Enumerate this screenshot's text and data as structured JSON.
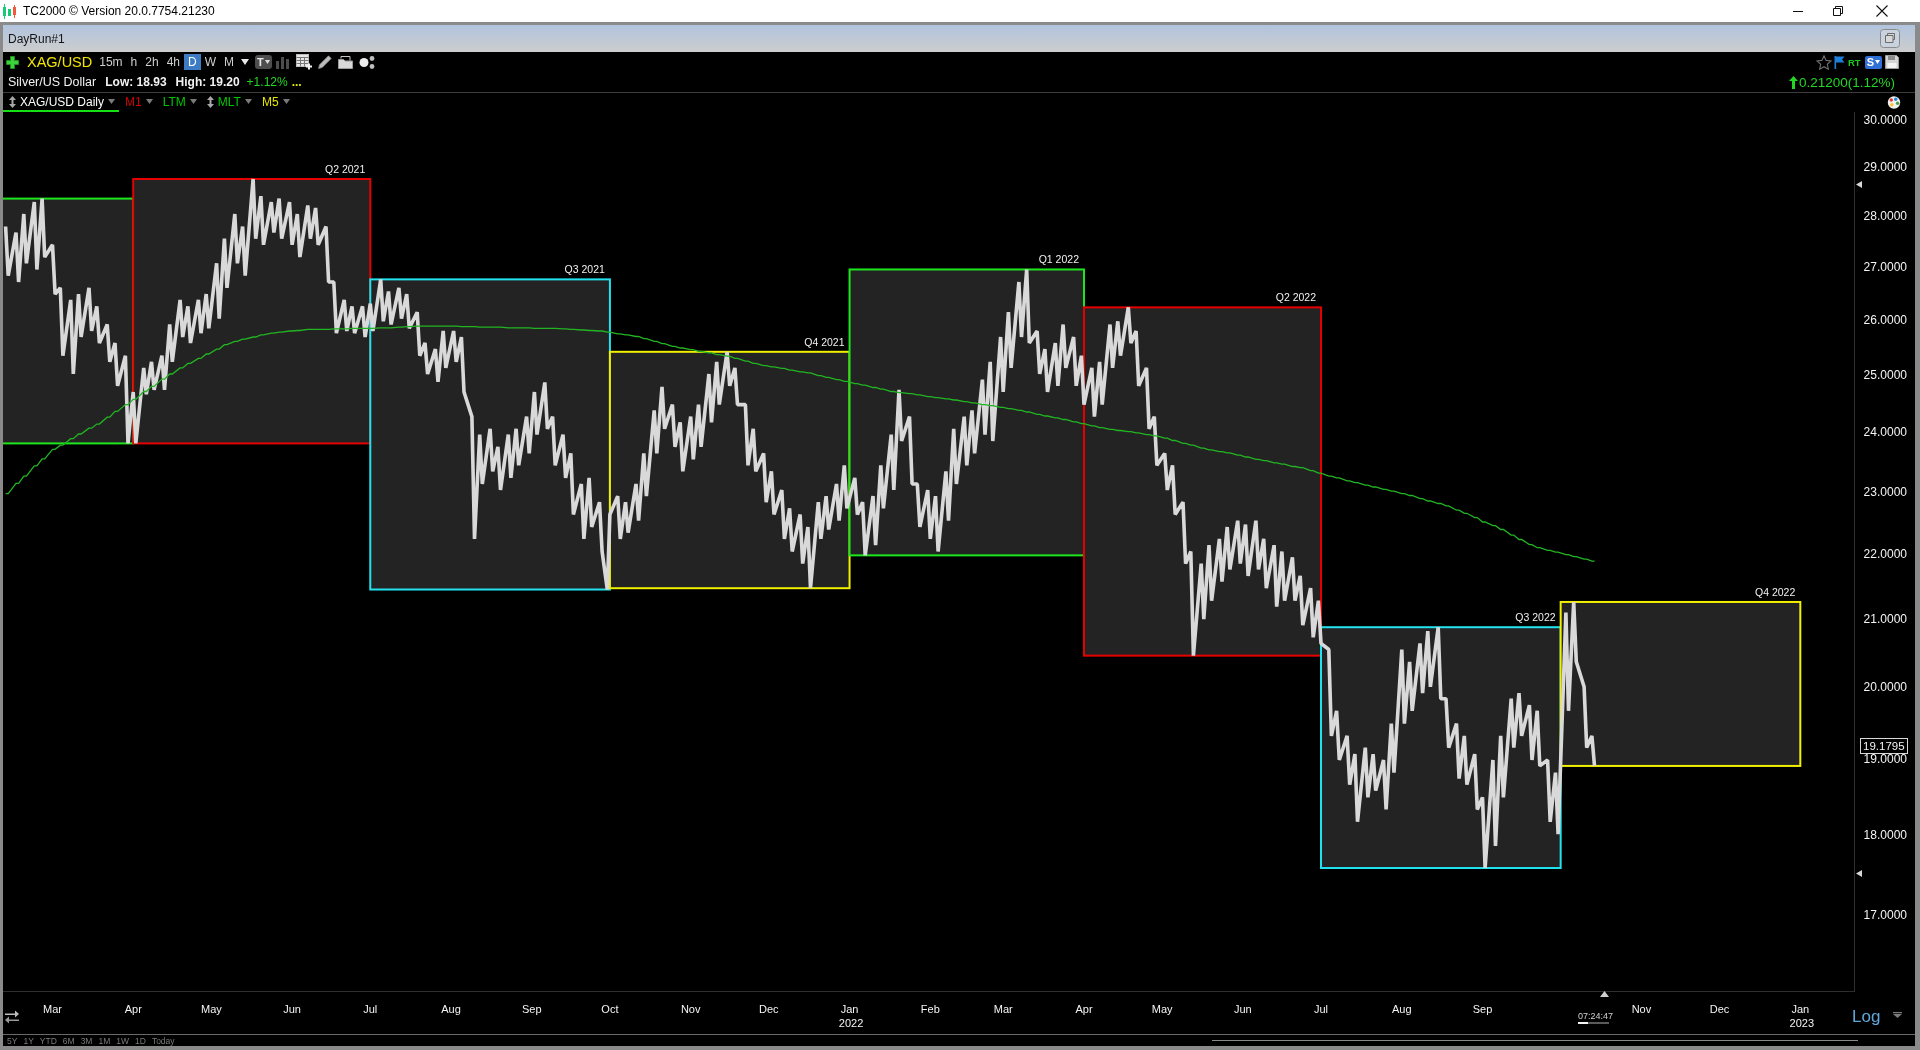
{
  "window": {
    "title": "TC2000 © Version 20.0.7754.21230"
  },
  "layout": {
    "title": "DayRun#1"
  },
  "toolbar": {
    "symbol": "XAG/USD",
    "timeframes": [
      {
        "label": "15m",
        "selected": false
      },
      {
        "label": "h",
        "selected": false
      },
      {
        "label": "2h",
        "selected": false
      },
      {
        "label": "4h",
        "selected": false
      },
      {
        "label": "D",
        "selected": true
      },
      {
        "label": "W",
        "selected": false
      },
      {
        "label": "M",
        "selected": false
      }
    ],
    "text_tool": "T",
    "realtime": "RT",
    "scan_menu": "S"
  },
  "quote": {
    "name": "Silver/US Dollar",
    "low": "Low: 18.93",
    "high": "High: 19.20",
    "change_percent": "+1.12%",
    "more": "...",
    "rising": true,
    "change": "0.21200(1.12%)"
  },
  "indicators": [
    {
      "label": "XAG/USD Daily",
      "handle": true,
      "selected": true
    },
    {
      "label": "M1",
      "color": "#cc0000",
      "handle": false,
      "selected": false
    },
    {
      "label": "LTM",
      "color": "#00c800",
      "handle": false,
      "selected": false
    },
    {
      "label": "MLT",
      "color": "#00c800",
      "handle": true,
      "selected": false
    },
    {
      "label": "M5",
      "color": "#e6e600",
      "handle": false,
      "selected": false
    }
  ],
  "chart_data": {
    "type": "line",
    "log": true,
    "xlim": [
      "2021-02-10",
      "2023-01-22"
    ],
    "ylim": [
      16.09,
      30.17
    ],
    "x": [
      "2021-02-11",
      "2021-02-12",
      "2021-02-15",
      "2021-02-16",
      "2021-02-18",
      "2021-02-19",
      "2021-02-22",
      "2021-02-23",
      "2021-02-25",
      "2021-02-26",
      "2021-03-01",
      "2021-03-02",
      "2021-03-04",
      "2021-03-05",
      "2021-03-08",
      "2021-03-09",
      "2021-03-11",
      "2021-03-12",
      "2021-03-15",
      "2021-03-16",
      "2021-03-18",
      "2021-03-19",
      "2021-03-22",
      "2021-03-23",
      "2021-03-25",
      "2021-03-26",
      "2021-03-29",
      "2021-03-30",
      "2021-04-01",
      "2021-04-02",
      "2021-04-05",
      "2021-04-06",
      "2021-04-08",
      "2021-04-09",
      "2021-04-12",
      "2021-04-13",
      "2021-04-15",
      "2021-04-16",
      "2021-04-19",
      "2021-04-20",
      "2021-04-22",
      "2021-04-23",
      "2021-04-26",
      "2021-04-27",
      "2021-04-29",
      "2021-04-30",
      "2021-05-03",
      "2021-05-04",
      "2021-05-06",
      "2021-05-07",
      "2021-05-10",
      "2021-05-11",
      "2021-05-13",
      "2021-05-14",
      "2021-05-17",
      "2021-05-18",
      "2021-05-20",
      "2021-05-21",
      "2021-05-24",
      "2021-05-25",
      "2021-05-27",
      "2021-05-28",
      "2021-05-31",
      "2021-06-01",
      "2021-06-03",
      "2021-06-04",
      "2021-06-07",
      "2021-06-08",
      "2021-06-10",
      "2021-06-11",
      "2021-06-14",
      "2021-06-15",
      "2021-06-17",
      "2021-06-18",
      "2021-06-21",
      "2021-06-22",
      "2021-06-24",
      "2021-06-25",
      "2021-06-28",
      "2021-06-29",
      "2021-07-01",
      "2021-07-02",
      "2021-07-05",
      "2021-07-06",
      "2021-07-08",
      "2021-07-09",
      "2021-07-12",
      "2021-07-13",
      "2021-07-15",
      "2021-07-16",
      "2021-07-19",
      "2021-07-20",
      "2021-07-22",
      "2021-07-23",
      "2021-07-26",
      "2021-07-27",
      "2021-07-29",
      "2021-07-30",
      "2021-08-02",
      "2021-08-03",
      "2021-08-05",
      "2021-08-06",
      "2021-08-09",
      "2021-08-10",
      "2021-08-12",
      "2021-08-13",
      "2021-08-16",
      "2021-08-17",
      "2021-08-19",
      "2021-08-20",
      "2021-08-23",
      "2021-08-24",
      "2021-08-26",
      "2021-08-27",
      "2021-08-30",
      "2021-08-31",
      "2021-09-02",
      "2021-09-03",
      "2021-09-06",
      "2021-09-07",
      "2021-09-09",
      "2021-09-10",
      "2021-09-13",
      "2021-09-14",
      "2021-09-16",
      "2021-09-17",
      "2021-09-20",
      "2021-09-21",
      "2021-09-23",
      "2021-09-24",
      "2021-09-27",
      "2021-09-28",
      "2021-09-30",
      "2021-10-01",
      "2021-10-04",
      "2021-10-05",
      "2021-10-07",
      "2021-10-08",
      "2021-10-11",
      "2021-10-12",
      "2021-10-14",
      "2021-10-15",
      "2021-10-18",
      "2021-10-19",
      "2021-10-21",
      "2021-10-22",
      "2021-10-25",
      "2021-10-26",
      "2021-10-28",
      "2021-10-29",
      "2021-11-01",
      "2021-11-02",
      "2021-11-04",
      "2021-11-05",
      "2021-11-08",
      "2021-11-09",
      "2021-11-11",
      "2021-11-12",
      "2021-11-15",
      "2021-11-16",
      "2021-11-18",
      "2021-11-19",
      "2021-11-22",
      "2021-11-23",
      "2021-11-25",
      "2021-11-26",
      "2021-11-29",
      "2021-11-30",
      "2021-12-02",
      "2021-12-03",
      "2021-12-06",
      "2021-12-07",
      "2021-12-09",
      "2021-12-10",
      "2021-12-13",
      "2021-12-14",
      "2021-12-16",
      "2021-12-17",
      "2021-12-20",
      "2021-12-21",
      "2021-12-23",
      "2021-12-24",
      "2021-12-27",
      "2021-12-28",
      "2021-12-30",
      "2021-12-31",
      "2022-01-03",
      "2022-01-04",
      "2022-01-06",
      "2022-01-07",
      "2022-01-10",
      "2022-01-11",
      "2022-01-13",
      "2022-01-14",
      "2022-01-17",
      "2022-01-18",
      "2022-01-20",
      "2022-01-21",
      "2022-01-24",
      "2022-01-25",
      "2022-01-27",
      "2022-01-28",
      "2022-01-31",
      "2022-02-01",
      "2022-02-03",
      "2022-02-04",
      "2022-02-07",
      "2022-02-08",
      "2022-02-10",
      "2022-02-11",
      "2022-02-14",
      "2022-02-15",
      "2022-02-17",
      "2022-02-18",
      "2022-02-21",
      "2022-02-22",
      "2022-02-24",
      "2022-02-25",
      "2022-02-28",
      "2022-03-01",
      "2022-03-03",
      "2022-03-04",
      "2022-03-07",
      "2022-03-08",
      "2022-03-10",
      "2022-03-11",
      "2022-03-14",
      "2022-03-15",
      "2022-03-17",
      "2022-03-18",
      "2022-03-21",
      "2022-03-22",
      "2022-03-24",
      "2022-03-25",
      "2022-03-28",
      "2022-03-29",
      "2022-03-31",
      "2022-04-01",
      "2022-04-04",
      "2022-04-05",
      "2022-04-07",
      "2022-04-08",
      "2022-04-11",
      "2022-04-12",
      "2022-04-14",
      "2022-04-15",
      "2022-04-18",
      "2022-04-19",
      "2022-04-21",
      "2022-04-22",
      "2022-04-25",
      "2022-04-26",
      "2022-04-28",
      "2022-04-29",
      "2022-05-02",
      "2022-05-03",
      "2022-05-05",
      "2022-05-06",
      "2022-05-09",
      "2022-05-10",
      "2022-05-12",
      "2022-05-13",
      "2022-05-16",
      "2022-05-17",
      "2022-05-19",
      "2022-05-20",
      "2022-05-23",
      "2022-05-24",
      "2022-05-26",
      "2022-05-27",
      "2022-05-30",
      "2022-05-31",
      "2022-06-02",
      "2022-06-03",
      "2022-06-06",
      "2022-06-07",
      "2022-06-09",
      "2022-06-10",
      "2022-06-13",
      "2022-06-14",
      "2022-06-16",
      "2022-06-17",
      "2022-06-20",
      "2022-06-21",
      "2022-06-23",
      "2022-06-24",
      "2022-06-27",
      "2022-06-28",
      "2022-06-30",
      "2022-07-01",
      "2022-07-04",
      "2022-07-05",
      "2022-07-07",
      "2022-07-08",
      "2022-07-11",
      "2022-07-12",
      "2022-07-14",
      "2022-07-15",
      "2022-07-18",
      "2022-07-19",
      "2022-07-21",
      "2022-07-22",
      "2022-07-25",
      "2022-07-26",
      "2022-07-28",
      "2022-07-29",
      "2022-08-01",
      "2022-08-02",
      "2022-08-04",
      "2022-08-05",
      "2022-08-08",
      "2022-08-09",
      "2022-08-11",
      "2022-08-12",
      "2022-08-15",
      "2022-08-16",
      "2022-08-18",
      "2022-08-19",
      "2022-08-22",
      "2022-08-23",
      "2022-08-25",
      "2022-08-26",
      "2022-08-29",
      "2022-08-30",
      "2022-09-01",
      "2022-09-02",
      "2022-09-05",
      "2022-09-06",
      "2022-09-08",
      "2022-09-09",
      "2022-09-12",
      "2022-09-13",
      "2022-09-15",
      "2022-09-16",
      "2022-09-19",
      "2022-09-20",
      "2022-09-22",
      "2022-09-23",
      "2022-09-26",
      "2022-09-27",
      "2022-09-29",
      "2022-09-30",
      "2022-10-03",
      "2022-10-04",
      "2022-10-06",
      "2022-10-07",
      "2022-10-10",
      "2022-10-11",
      "2022-10-13",
      "2022-10-14"
    ],
    "series": [
      {
        "color": "#d9d9d9",
        "values": [
          27.8,
          26.84,
          27.68,
          26.72,
          28.05,
          27.08,
          28.29,
          26.96,
          28.36,
          27.2,
          27.44,
          26.49,
          26.61,
          25.35,
          26.38,
          25.02,
          26.49,
          25.69,
          26.61,
          25.8,
          26.26,
          25.58,
          25.92,
          25.24,
          25.58,
          24.81,
          25.35,
          23.81,
          24.7,
          23.81,
          25.13,
          24.66,
          25.24,
          24.74,
          25.35,
          24.74,
          25.92,
          25.24,
          26.38,
          25.69,
          26.26,
          25.58,
          26.38,
          25.76,
          26.49,
          25.85,
          27.08,
          26.03,
          27.56,
          26.61,
          28.05,
          27.08,
          27.8,
          26.84,
          28.76,
          27.56,
          28.41,
          27.44,
          28.29,
          27.68,
          28.36,
          27.56,
          28.29,
          27.44,
          28.05,
          27.2,
          28.22,
          27.56,
          28.17,
          27.44,
          27.8,
          26.72,
          26.72,
          25.76,
          26.38,
          25.8,
          26.26,
          25.76,
          26.26,
          25.69,
          26.31,
          25.8,
          26.77,
          25.98,
          26.54,
          25.92,
          26.61,
          26.03,
          26.49,
          25.85,
          26.15,
          25.35,
          25.58,
          25.02,
          25.47,
          24.88,
          25.8,
          25.13,
          25.8,
          25.24,
          25.69,
          24.7,
          24.27,
          22.24,
          23.96,
          23.13,
          24.06,
          23.34,
          23.75,
          23.03,
          23.96,
          23.23,
          24.06,
          23.44,
          24.27,
          23.64,
          24.7,
          23.96,
          24.87,
          24.06,
          24.27,
          23.44,
          23.96,
          23.23,
          23.64,
          22.63,
          23.13,
          22.24,
          23.23,
          22.43,
          22.83,
          22.04,
          21.45,
          22.63,
          22.93,
          22.24,
          22.83,
          22.34,
          23.13,
          22.53,
          23.64,
          22.93,
          24.38,
          23.64,
          24.79,
          24.06,
          24.48,
          23.75,
          24.17,
          23.34,
          24.27,
          23.54,
          24.48,
          23.75,
          25.02,
          24.17,
          25.24,
          24.48,
          25.42,
          24.81,
          25.13,
          24.48,
          24.48,
          23.44,
          24.06,
          23.34,
          23.64,
          22.83,
          23.34,
          22.63,
          23.03,
          22.24,
          22.73,
          22.04,
          22.63,
          21.85,
          22.43,
          21.47,
          22.83,
          22.24,
          22.93,
          22.39,
          23.13,
          22.53,
          23.44,
          22.73,
          23.23,
          22.63,
          22.83,
          21.98,
          22.93,
          22.14,
          23.44,
          22.73,
          23.96,
          23.03,
          24.74,
          23.85,
          24.27,
          23.13,
          23.13,
          22.43,
          23.03,
          22.24,
          22.93,
          22.04,
          23.34,
          22.53,
          24.06,
          23.13,
          24.27,
          23.44,
          24.38,
          23.64,
          24.92,
          23.96,
          25.24,
          23.85,
          25.69,
          24.7,
          26.15,
          25.13,
          26.72,
          25.69,
          26.96,
          25.58,
          25.8,
          25.02,
          25.47,
          24.7,
          25.58,
          24.81,
          25.92,
          25.13,
          25.69,
          24.81,
          25.35,
          24.48,
          25.13,
          24.27,
          25.24,
          24.48,
          25.92,
          25.13,
          25.98,
          25.35,
          26.24,
          25.58,
          25.8,
          24.81,
          25.13,
          24.06,
          24.27,
          23.44,
          23.64,
          23.03,
          23.44,
          22.63,
          22.83,
          21.85,
          22.04,
          20.46,
          21.85,
          21.0,
          22.14,
          21.28,
          22.24,
          21.57,
          22.43,
          21.76,
          22.53,
          21.85,
          22.47,
          21.66,
          22.53,
          21.76,
          22.24,
          21.47,
          22.14,
          21.19,
          22.04,
          21.28,
          21.95,
          21.28,
          21.66,
          20.91,
          21.47,
          20.73,
          21.28,
          20.64,
          20.55,
          19.32,
          19.67,
          18.99,
          19.32,
          18.66,
          19.07,
          18.17,
          19.16,
          18.49,
          19.07,
          18.58,
          18.99,
          18.33,
          19.49,
          18.82,
          20.55,
          19.49,
          20.37,
          19.67,
          20.64,
          19.92,
          20.82,
          20.01,
          20.88,
          19.84,
          19.84,
          19.16,
          19.49,
          18.74,
          19.32,
          18.66,
          19.07,
          18.33,
          18.49,
          17.58,
          18.99,
          17.86,
          19.32,
          18.49,
          19.84,
          19.16,
          19.92,
          19.32,
          19.75,
          18.99,
          19.67,
          18.91,
          18.99,
          18.17,
          18.82,
          18.01,
          21.1,
          19.67,
          21.26,
          20.37,
          20.01,
          19.16,
          19.32,
          18.91
        ]
      },
      {
        "color": "#22b522",
        "values": [
          22.97,
          22.97,
          23.14,
          23.14,
          23.26,
          23.26,
          23.43,
          23.43,
          23.55,
          23.55,
          23.71,
          23.71,
          23.78,
          23.78,
          23.89,
          23.89,
          23.97,
          23.97,
          24.07,
          24.07,
          24.14,
          24.14,
          24.26,
          24.26,
          24.36,
          24.36,
          24.48,
          24.48,
          24.57,
          24.57,
          24.71,
          24.71,
          24.8,
          24.8,
          24.93,
          24.93,
          25.02,
          25.02,
          25.13,
          25.13,
          25.21,
          25.21,
          25.3,
          25.3,
          25.38,
          25.38,
          25.47,
          25.47,
          25.55,
          25.55,
          25.61,
          25.61,
          25.65,
          25.65,
          25.69,
          25.69,
          25.73,
          25.73,
          25.76,
          25.76,
          25.78,
          25.78,
          25.8,
          25.8,
          25.81,
          25.81,
          25.83,
          25.83,
          25.83,
          25.83,
          25.83,
          25.83,
          25.84,
          25.84,
          25.84,
          25.84,
          25.85,
          25.85,
          25.85,
          25.85,
          25.85,
          25.85,
          25.86,
          25.86,
          25.86,
          25.86,
          25.87,
          25.87,
          25.88,
          25.88,
          25.89,
          25.89,
          25.89,
          25.89,
          25.89,
          25.89,
          25.89,
          25.89,
          25.89,
          25.89,
          25.88,
          25.88,
          25.88,
          25.88,
          25.87,
          25.87,
          25.87,
          25.87,
          25.87,
          25.87,
          25.86,
          25.86,
          25.86,
          25.86,
          25.86,
          25.86,
          25.85,
          25.85,
          25.85,
          25.85,
          25.85,
          25.85,
          25.84,
          25.84,
          25.83,
          25.83,
          25.82,
          25.82,
          25.81,
          25.81,
          25.8,
          25.8,
          25.78,
          25.78,
          25.75,
          25.75,
          25.73,
          25.73,
          25.7,
          25.7,
          25.66,
          25.66,
          25.61,
          25.61,
          25.57,
          25.57,
          25.52,
          25.52,
          25.49,
          25.49,
          25.46,
          25.46,
          25.43,
          25.43,
          25.4,
          25.4,
          25.37,
          25.37,
          25.34,
          25.34,
          25.3,
          25.3,
          25.25,
          25.25,
          25.21,
          25.21,
          25.17,
          25.17,
          25.15,
          25.15,
          25.12,
          25.12,
          25.09,
          25.09,
          25.06,
          25.06,
          25.04,
          25.04,
          24.99,
          24.99,
          24.96,
          24.96,
          24.92,
          24.92,
          24.89,
          24.89,
          24.85,
          24.85,
          24.82,
          24.82,
          24.78,
          24.78,
          24.75,
          24.75,
          24.71,
          24.71,
          24.69,
          24.69,
          24.67,
          24.67,
          24.65,
          24.65,
          24.62,
          24.62,
          24.6,
          24.6,
          24.58,
          24.58,
          24.56,
          24.56,
          24.53,
          24.53,
          24.51,
          24.51,
          24.48,
          24.48,
          24.46,
          24.46,
          24.43,
          24.43,
          24.41,
          24.41,
          24.38,
          24.38,
          24.35,
          24.35,
          24.31,
          24.31,
          24.28,
          24.28,
          24.25,
          24.25,
          24.22,
          24.22,
          24.18,
          24.18,
          24.15,
          24.15,
          24.11,
          24.11,
          24.08,
          24.08,
          24.05,
          24.05,
          24.03,
          24.03,
          24.01,
          24.01,
          23.99,
          23.99,
          23.96,
          23.96,
          23.94,
          23.94,
          23.9,
          23.9,
          23.86,
          23.86,
          23.81,
          23.81,
          23.78,
          23.78,
          23.73,
          23.73,
          23.7,
          23.7,
          23.67,
          23.67,
          23.65,
          23.65,
          23.61,
          23.61,
          23.58,
          23.58,
          23.54,
          23.54,
          23.52,
          23.52,
          23.48,
          23.48,
          23.46,
          23.46,
          23.42,
          23.42,
          23.4,
          23.4,
          23.35,
          23.35,
          23.31,
          23.31,
          23.26,
          23.26,
          23.23,
          23.23,
          23.18,
          23.18,
          23.15,
          23.15,
          23.11,
          23.11,
          23.08,
          23.08,
          23.04,
          23.04,
          23.01,
          23.01,
          22.97,
          22.97,
          22.94,
          22.94,
          22.89,
          22.89,
          22.85,
          22.85,
          22.81,
          22.81,
          22.77,
          22.77,
          22.7,
          22.7,
          22.65,
          22.65,
          22.58,
          22.58,
          22.51,
          22.51,
          22.45,
          22.45,
          22.39,
          22.39,
          22.3,
          22.3,
          22.23,
          22.23,
          22.15,
          22.15,
          22.1,
          22.1,
          22.06,
          22.06,
          22.03,
          22.03,
          21.99,
          21.99,
          21.96,
          21.96,
          21.92,
          21.92,
          21.89,
          21.89
        ]
      }
    ],
    "yticks": [
      {
        "value": 30,
        "label": "30.0000"
      },
      {
        "value": 29,
        "label": "29.0000"
      },
      {
        "value": 28,
        "label": "28.0000"
      },
      {
        "value": 27,
        "label": "27.0000"
      },
      {
        "value": 26,
        "label": "26.0000"
      },
      {
        "value": 25,
        "label": "25.0000"
      },
      {
        "value": 24,
        "label": "24.0000"
      },
      {
        "value": 23,
        "label": "23.0000"
      },
      {
        "value": 22,
        "label": "22.0000"
      },
      {
        "value": 21,
        "label": "21.0000"
      },
      {
        "value": 20,
        "label": "20.0000"
      },
      {
        "value": 19,
        "label": "19.0000"
      },
      {
        "value": 18,
        "label": "18.0000"
      },
      {
        "value": 17,
        "label": "17.0000"
      }
    ],
    "xticks": [
      {
        "value": "2021-03-01",
        "label": "Mar"
      },
      {
        "value": "2021-04-01",
        "label": "Apr"
      },
      {
        "value": "2021-05-01",
        "label": "May"
      },
      {
        "value": "2021-06-01",
        "label": "Jun"
      },
      {
        "value": "2021-07-01",
        "label": "Jul"
      },
      {
        "value": "2021-08-01",
        "label": "Aug"
      },
      {
        "value": "2021-09-01",
        "label": "Sep"
      },
      {
        "value": "2021-10-01",
        "label": "Oct"
      },
      {
        "value": "2021-11-01",
        "label": "Nov"
      },
      {
        "value": "2021-12-01",
        "label": "Dec"
      },
      {
        "value": "2022-01-01",
        "label": "Jan 2022"
      },
      {
        "value": "2022-02-01",
        "label": "Feb"
      },
      {
        "value": "2022-03-01",
        "label": "Mar"
      },
      {
        "value": "2022-04-01",
        "label": "Apr"
      },
      {
        "value": "2022-05-01",
        "label": "May"
      },
      {
        "value": "2022-06-01",
        "label": "Jun"
      },
      {
        "value": "2022-07-01",
        "label": "Jul"
      },
      {
        "value": "2022-08-01",
        "label": "Aug"
      },
      {
        "value": "2022-09-01",
        "label": "Sep"
      },
      {
        "value": "2022-11-01",
        "label": "Nov"
      },
      {
        "value": "2022-12-01",
        "label": "Dec"
      },
      {
        "value": "2023-01-01",
        "label": "Jan 2023"
      }
    ],
    "annotations": [
      "19.1795"
    ],
    "bands": [
      {
        "axis": "x",
        "from": "2021-01-01",
        "to": "2021-03-31",
        "color": "#1ee61e"
      },
      {
        "axis": "x",
        "from": "2021-04-01",
        "to": "2021-06-30",
        "color": "#e60000",
        "label": "Q2 2021"
      },
      {
        "axis": "x",
        "from": "2021-07-01",
        "to": "2021-09-30",
        "color": "#22e2f0",
        "label": "Q3 2021"
      },
      {
        "axis": "x",
        "from": "2021-10-01",
        "to": "2021-12-31",
        "color": "#f0f000",
        "label": "Q4 2021"
      },
      {
        "axis": "x",
        "from": "2022-01-01",
        "to": "2022-03-31",
        "color": "#1ee61e",
        "label": "Q1 2022"
      },
      {
        "axis": "x",
        "from": "2022-04-01",
        "to": "2022-06-30",
        "color": "#e60000",
        "label": "Q2 2022"
      },
      {
        "axis": "x",
        "from": "2022-07-01",
        "to": "2022-09-30",
        "color": "#22e2f0",
        "label": "Q3 2022"
      },
      {
        "axis": "x",
        "from": "2022-10-01",
        "to": "2022-12-31",
        "color": "#f0f000",
        "label": "Q4 2022"
      }
    ]
  },
  "bar_timer": {
    "time": "07:24:47",
    "level": 0.33
  },
  "scale_button": "Log",
  "range_buttons": [
    "5Y",
    "1Y",
    "YTD",
    "6M",
    "3M",
    "1M",
    "1W",
    "1D",
    "Today"
  ]
}
